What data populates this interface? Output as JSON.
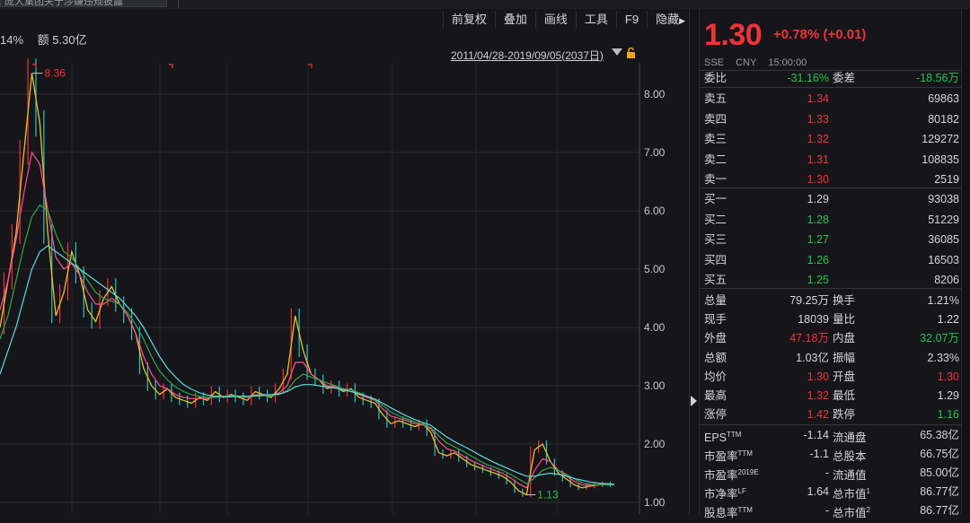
{
  "window": {
    "tab_title": "庞大集团关于涉嫌违规披露",
    "toolbar": [
      "前复权",
      "叠加",
      "画线",
      "工具",
      "F9",
      "隐藏"
    ]
  },
  "info": {
    "pct_text": "14%",
    "amount_text": "额 5.30亿"
  },
  "chart_header": {
    "date_range": "2011/04/28-2019/09/05(2037日)"
  },
  "chart_data": {
    "type": "line",
    "ylim": [
      1.0,
      8.6
    ],
    "yticks": [
      "8.00",
      "7.00",
      "6.00",
      "5.00",
      "4.00",
      "3.00",
      "2.00",
      "1.00"
    ],
    "annotations": {
      "high": "8.36",
      "low": "1.13"
    },
    "series": [
      {
        "values": [
          4.0,
          4.8,
          5.6,
          7.0,
          8.36,
          7.5,
          5.6,
          4.2,
          4.6,
          5.3,
          4.9,
          4.3,
          4.1,
          4.5,
          4.7,
          4.4,
          4.2,
          3.9,
          3.3,
          3.0,
          2.85,
          2.95,
          2.8,
          2.75,
          2.7,
          2.8,
          2.75,
          2.9,
          2.8,
          2.85,
          2.8,
          2.75,
          2.9,
          2.85,
          2.8,
          2.95,
          3.2,
          4.2,
          3.6,
          3.2,
          3.1,
          2.95,
          3.0,
          2.9,
          2.95,
          2.8,
          2.75,
          2.7,
          2.5,
          2.35,
          2.4,
          2.35,
          2.3,
          2.35,
          2.2,
          1.85,
          1.8,
          1.85,
          1.75,
          1.65,
          1.6,
          1.55,
          1.5,
          1.45,
          1.35,
          1.2,
          1.13,
          1.9,
          2.0,
          1.7,
          1.5,
          1.4,
          1.3,
          1.25,
          1.28,
          1.3,
          1.32,
          1.3
        ]
      },
      {
        "values": [
          4.3,
          4.8,
          5.5,
          6.3,
          7.0,
          6.8,
          6.0,
          5.2,
          5.0,
          5.1,
          4.9,
          4.6,
          4.4,
          4.4,
          4.5,
          4.4,
          4.2,
          3.9,
          3.5,
          3.2,
          3.0,
          2.95,
          2.85,
          2.8,
          2.78,
          2.78,
          2.78,
          2.82,
          2.82,
          2.83,
          2.82,
          2.8,
          2.84,
          2.85,
          2.84,
          2.88,
          3.0,
          3.4,
          3.4,
          3.2,
          3.1,
          3.0,
          2.98,
          2.93,
          2.93,
          2.85,
          2.8,
          2.75,
          2.6,
          2.48,
          2.44,
          2.4,
          2.35,
          2.33,
          2.26,
          2.05,
          1.92,
          1.88,
          1.8,
          1.72,
          1.66,
          1.6,
          1.55,
          1.5,
          1.42,
          1.32,
          1.25,
          1.55,
          1.75,
          1.7,
          1.55,
          1.45,
          1.36,
          1.3,
          1.29,
          1.3,
          1.31,
          1.3
        ]
      },
      {
        "values": [
          3.8,
          4.2,
          4.8,
          5.4,
          5.9,
          6.1,
          6.0,
          5.6,
          5.3,
          5.2,
          5.0,
          4.8,
          4.6,
          4.5,
          4.45,
          4.4,
          4.25,
          4.05,
          3.8,
          3.5,
          3.25,
          3.1,
          2.98,
          2.9,
          2.85,
          2.82,
          2.8,
          2.8,
          2.82,
          2.82,
          2.82,
          2.81,
          2.82,
          2.83,
          2.83,
          2.85,
          2.92,
          3.1,
          3.2,
          3.15,
          3.1,
          3.05,
          3.0,
          2.95,
          2.93,
          2.88,
          2.82,
          2.76,
          2.66,
          2.55,
          2.48,
          2.43,
          2.38,
          2.34,
          2.28,
          2.14,
          2.02,
          1.95,
          1.88,
          1.8,
          1.72,
          1.65,
          1.6,
          1.55,
          1.48,
          1.4,
          1.32,
          1.42,
          1.55,
          1.6,
          1.55,
          1.48,
          1.4,
          1.34,
          1.31,
          1.3,
          1.3,
          1.3
        ]
      },
      {
        "values": [
          3.2,
          3.6,
          4.0,
          4.5,
          5.0,
          5.3,
          5.4,
          5.3,
          5.2,
          5.1,
          5.0,
          4.9,
          4.8,
          4.7,
          4.6,
          4.5,
          4.35,
          4.2,
          4.0,
          3.75,
          3.5,
          3.3,
          3.15,
          3.02,
          2.94,
          2.88,
          2.84,
          2.82,
          2.81,
          2.81,
          2.82,
          2.82,
          2.83,
          2.84,
          2.85,
          2.86,
          2.9,
          2.98,
          3.02,
          3.02,
          3.0,
          2.98,
          2.96,
          2.93,
          2.9,
          2.86,
          2.82,
          2.77,
          2.7,
          2.62,
          2.55,
          2.48,
          2.42,
          2.37,
          2.32,
          2.22,
          2.12,
          2.04,
          1.97,
          1.9,
          1.82,
          1.75,
          1.68,
          1.62,
          1.56,
          1.5,
          1.45,
          1.45,
          1.48,
          1.5,
          1.48,
          1.45,
          1.41,
          1.38,
          1.35,
          1.33,
          1.32,
          1.31
        ]
      }
    ]
  },
  "quote": {
    "price": "1.30",
    "change": "+0.78% (+0.01)",
    "exchange": "SSE",
    "currency": "CNY",
    "time": "15:00:00",
    "ratio_label": "委比",
    "ratio_value": "-31.16%",
    "diff_label": "委差",
    "diff_value": "-18.56万",
    "asks": [
      {
        "label": "卖五",
        "price": "1.34",
        "vol": "69863"
      },
      {
        "label": "卖四",
        "price": "1.33",
        "vol": "80182"
      },
      {
        "label": "卖三",
        "price": "1.32",
        "vol": "129272"
      },
      {
        "label": "卖二",
        "price": "1.31",
        "vol": "108835"
      },
      {
        "label": "卖一",
        "price": "1.30",
        "vol": "2519"
      }
    ],
    "bids": [
      {
        "label": "买一",
        "price": "1.29",
        "vol": "93038"
      },
      {
        "label": "买二",
        "price": "1.28",
        "vol": "51229"
      },
      {
        "label": "买三",
        "price": "1.27",
        "vol": "36085"
      },
      {
        "label": "买四",
        "price": "1.26",
        "vol": "16503"
      },
      {
        "label": "买五",
        "price": "1.25",
        "vol": "8206"
      }
    ],
    "stats": [
      {
        "l1": "总量",
        "v1": "79.25万",
        "l2": "换手",
        "v2": "1.21%"
      },
      {
        "l1": "现手",
        "v1": "18039",
        "l2": "量比",
        "v2": "1.22"
      },
      {
        "l1": "外盘",
        "v1": "47.18万",
        "l2": "内盘",
        "v2": "32.07万"
      },
      {
        "l1": "总额",
        "v1": "1.03亿",
        "l2": "振幅",
        "v2": "2.33%"
      },
      {
        "l1": "均价",
        "v1": "1.30",
        "l2": "开盘",
        "v2": "1.30"
      },
      {
        "l1": "最高",
        "v1": "1.32",
        "l2": "最低",
        "v2": "1.29"
      },
      {
        "l1": "涨停",
        "v1": "1.42",
        "l2": "跌停",
        "v2": "1.16"
      }
    ],
    "fundamentals": [
      {
        "l1": "EPS",
        "s1": "TTM",
        "v1": "-1.14",
        "l2": "流通盘",
        "s2": "",
        "v2": "65.38亿"
      },
      {
        "l1": "市盈率",
        "s1": "TTM",
        "v1": "-1.1",
        "l2": "总股本",
        "s2": "",
        "v2": "66.75亿"
      },
      {
        "l1": "市盈率",
        "s1": "2019E",
        "v1": "-",
        "l2": "流通值",
        "s2": "",
        "v2": "85.00亿"
      },
      {
        "l1": "市净率",
        "s1": "LF",
        "v1": "1.64",
        "l2": "总市值",
        "s2": "1",
        "v2": "86.77亿"
      },
      {
        "l1": "股息率",
        "s1": "TTM",
        "v1": "-",
        "l2": "总市值",
        "s2": "2",
        "v2": "86.77亿"
      }
    ]
  }
}
